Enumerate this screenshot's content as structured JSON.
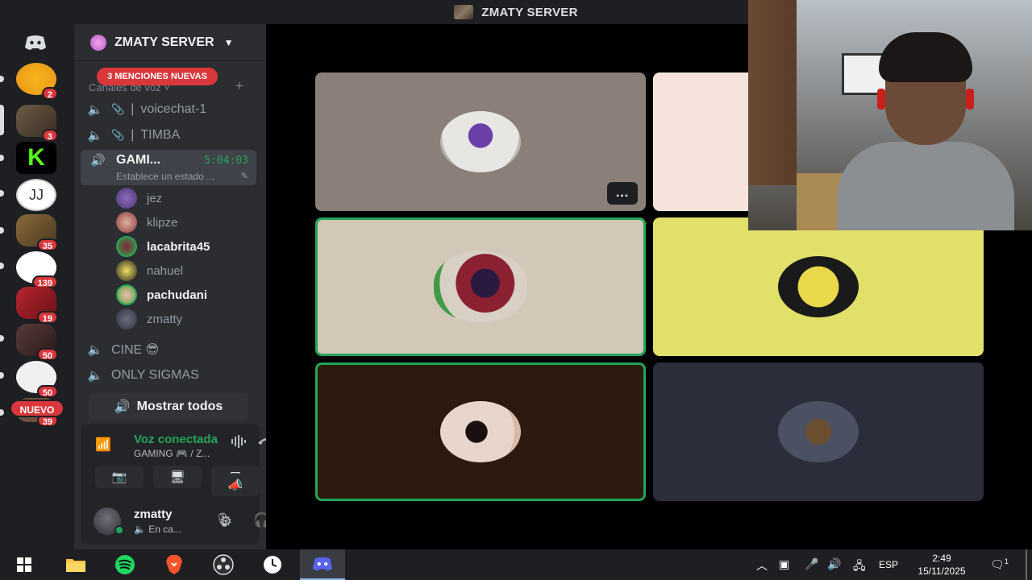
{
  "window": {
    "title": "ZMATY SERVER"
  },
  "rail": {
    "badges": [
      "2",
      "3",
      "35",
      "139",
      "19",
      "50",
      "50",
      "39"
    ],
    "nuevo_label": "NUEVO"
  },
  "sidebar": {
    "server_name": "ZMATY SERVER",
    "mentions_banner": "3 MENCIONES NUEVAS",
    "category": "Canales de voz",
    "channels": [
      {
        "name": "voicechat-1",
        "prefix": "| "
      },
      {
        "name": "TIMBA",
        "prefix": "| "
      },
      {
        "name": "GAMI...",
        "timer": "5:04:03",
        "status": "Establece un estado ..."
      },
      {
        "name": "CINE 😎"
      },
      {
        "name": "ONLY SIGMAS"
      }
    ],
    "users": [
      {
        "name": "jez",
        "color": "#7a5aa8"
      },
      {
        "name": "klipze",
        "color": "#b85a5a"
      },
      {
        "name": "lacabrita45",
        "color": "#3f9b45"
      },
      {
        "name": "nahuel",
        "color": "#e0c34a"
      },
      {
        "name": "pachudani",
        "color": "#6a9f3c"
      },
      {
        "name": "zmatty",
        "color": "#3d4152"
      }
    ],
    "show_all": "Mostrar todos"
  },
  "voice_panel": {
    "title": "Voz conectada",
    "subtitle": "GAMING 🎮 / Z...",
    "user_name": "zmatty",
    "user_status": "En ca..."
  },
  "tiles": [
    {
      "bg": "#8a8079",
      "ring": "#b8b6b2",
      "speaking": false
    },
    {
      "bg": "#f6e4dc",
      "ring": "#f6e4dc",
      "speaking": false
    },
    {
      "bg": "#d3c7b8",
      "ring": "#3f9b45",
      "speaking": true
    },
    {
      "bg": "#e1e06a",
      "ring": "#1a1a1a",
      "speaking": false
    },
    {
      "bg": "#2c1a0e",
      "ring": "#e8d6cc",
      "speaking": true
    },
    {
      "bg": "#2b2e3a",
      "ring": "#4b5163",
      "speaking": false
    }
  ],
  "more_button": "...",
  "taskbar": {
    "language": "ESP",
    "time": "2:49",
    "date": "15/11/2025",
    "notifications": "1"
  },
  "colors": {
    "accent_green": "#23a55a",
    "danger": "#da373c",
    "blurple": "#5865f2"
  }
}
